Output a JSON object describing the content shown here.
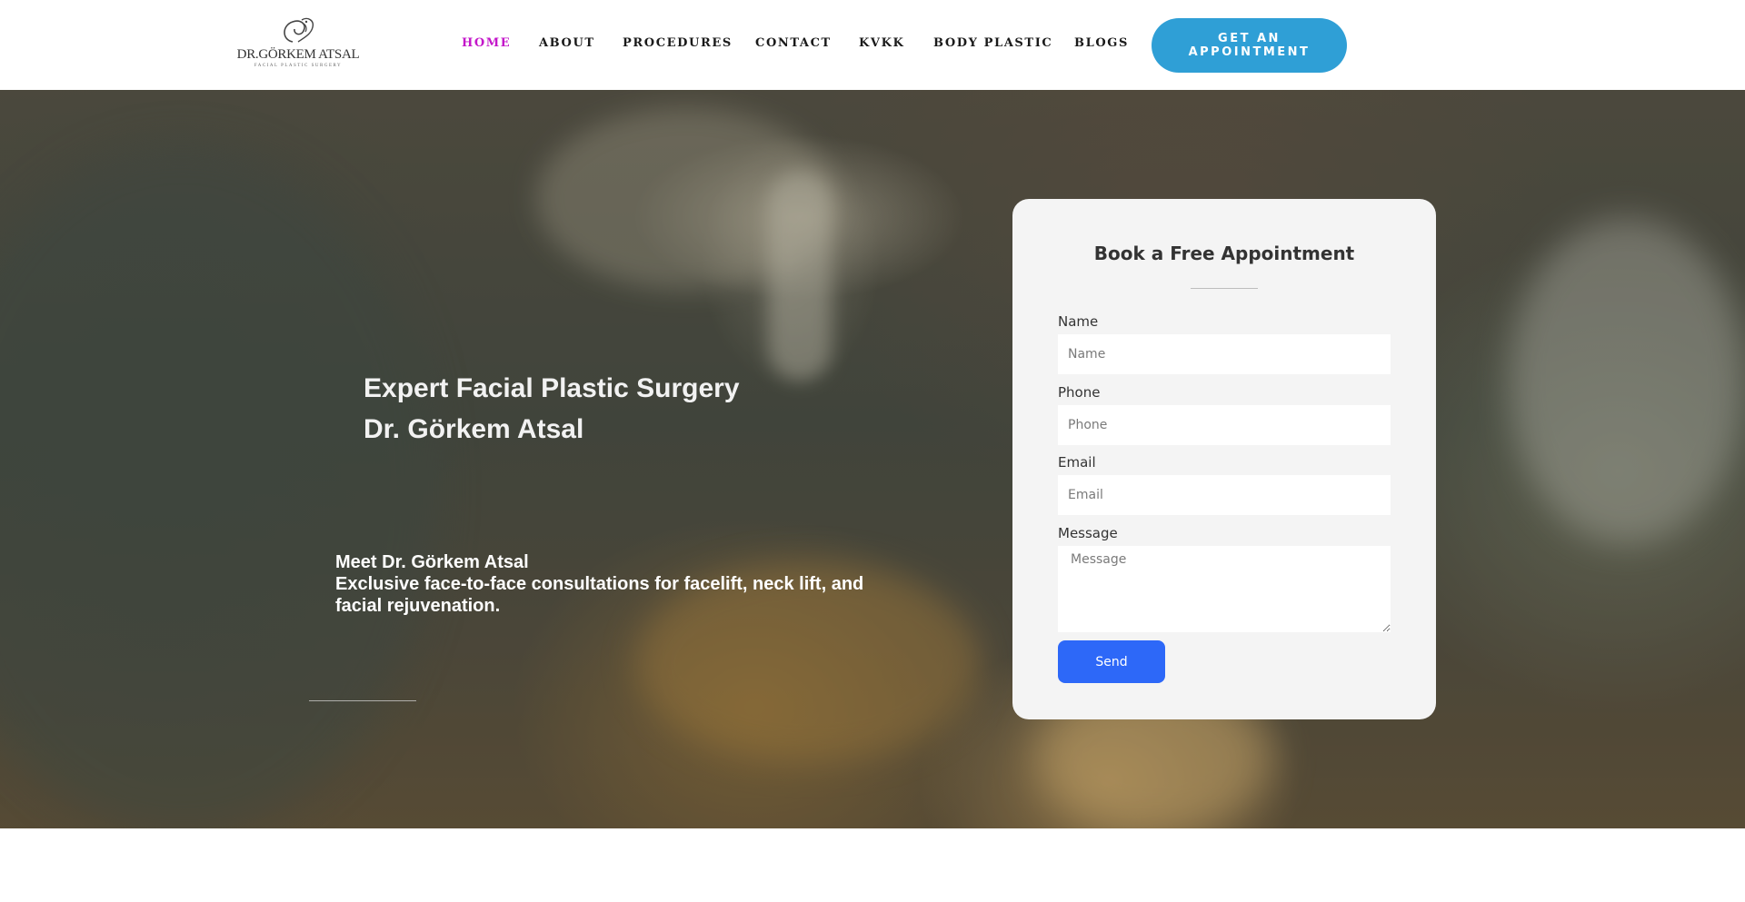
{
  "header": {
    "logo": {
      "name": "DR.GÖRKEM ATSAL",
      "tagline": "FACIAL PLASTIC SURGERY"
    },
    "nav": [
      {
        "label": "HOME",
        "active": true
      },
      {
        "label": "ABOUT",
        "active": false
      },
      {
        "label": "PROCEDURES",
        "active": false
      },
      {
        "label": "CONTACT",
        "active": false
      },
      {
        "label": "KVKK",
        "active": false
      },
      {
        "label": "BODY PLASTIC",
        "active": false
      },
      {
        "label": "BLOGS",
        "active": false
      }
    ],
    "cta_label": "GET AN APPOINTMENT"
  },
  "hero": {
    "title_line1": "Expert Facial Plastic Surgery",
    "title_line2": "Dr. Görkem Atsal",
    "text_line1": "Meet Dr. Görkem Atsal",
    "text_line2": "Exclusive face-to-face consultations for facelift, neck lift, and facial rejuvenation."
  },
  "form": {
    "title": "Book a Free Appointment",
    "name_label": "Name",
    "name_placeholder": "Name",
    "phone_label": "Phone",
    "phone_placeholder": "Phone",
    "email_label": "Email",
    "email_placeholder": "Email",
    "message_label": "Message",
    "message_placeholder": "Message",
    "send_label": "Send"
  },
  "colors": {
    "nav_active": "#c316c9",
    "cta_background": "#2f9fd6",
    "send_button": "#2d68f8",
    "card_background": "#f4f4f4"
  }
}
